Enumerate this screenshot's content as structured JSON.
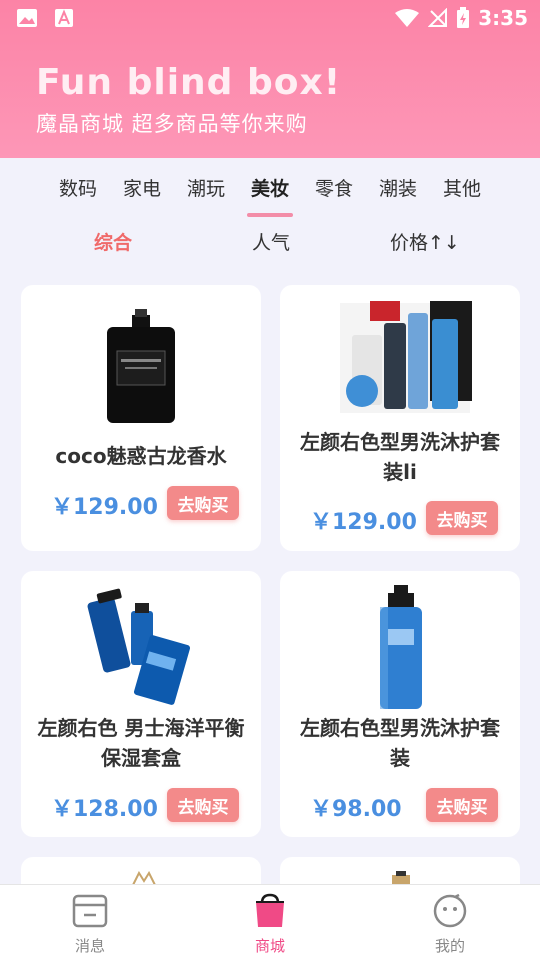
{
  "status_bar": {
    "time": "3:35"
  },
  "header": {
    "headline": "Fun blind box!",
    "subline": "魔晶商城  超多商品等你来购"
  },
  "categories": [
    "数码",
    "家电",
    "潮玩",
    "美妆",
    "零食",
    "潮装",
    "其他"
  ],
  "sort": [
    "综合",
    "人气",
    "价格↑↓"
  ],
  "products": [
    {
      "title": "coco魅惑古龙香水",
      "price": "￥129.00",
      "button": "去购买"
    },
    {
      "title": "左颜右色型男洗沐护套装li",
      "price": "￥129.00",
      "button": "去购买"
    },
    {
      "title": "左颜右色 男士海洋平衡保湿套盒",
      "price": "￥128.00",
      "button": "去购买"
    },
    {
      "title": "左颜右色型男洗沐护套装",
      "price": "￥98.00",
      "button": "去购买"
    }
  ],
  "nav": {
    "messages": "消息",
    "mall": "商城",
    "mine": "我的"
  },
  "colors": {
    "header_pink": "#fc83a6",
    "price_blue": "#4a8fe0",
    "buy_red": "#f38a8a",
    "active_sort": "#f06a6a",
    "nav_active": "#f04a86"
  }
}
